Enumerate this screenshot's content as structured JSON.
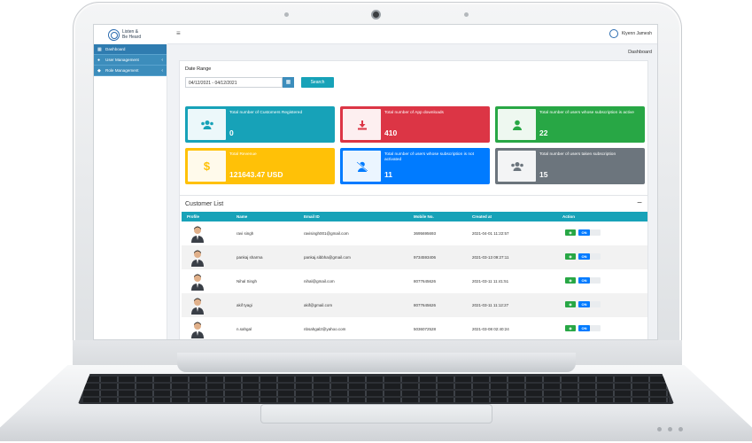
{
  "app": {
    "logo_text_line1": "Listen &",
    "logo_text_line2": "Be Heard",
    "menu_icon": "hamburger-icon"
  },
  "user": {
    "name": "Kiyenn Jamesh"
  },
  "breadcrumb": "Dashboard",
  "sidebar": {
    "items": [
      {
        "label": "Dashboard",
        "icon": "grid-icon",
        "arrow": ""
      },
      {
        "label": "User Management",
        "icon": "user-icon",
        "arrow": "‹"
      },
      {
        "label": "Role Management",
        "icon": "role-icon",
        "arrow": "‹"
      }
    ]
  },
  "filter": {
    "date_range_label": "Date Range",
    "date_range_value": "04/12/2021 - 04/12/2021",
    "search_label": "Search"
  },
  "stats": [
    {
      "label": "Total number of Customers Registered",
      "value": "0",
      "color": "#17a2b8",
      "icon": "users-icon"
    },
    {
      "label": "Total number of App downloads",
      "value": "410",
      "color": "#dc3545",
      "icon": "download-icon"
    },
    {
      "label": "Total number of users whose subscription is active",
      "value": "22",
      "color": "#28a745",
      "icon": "user-icon"
    },
    {
      "label": "Total Revenue",
      "value": "121643.47 USD",
      "color": "#ffc107",
      "icon": "dollar-icon"
    },
    {
      "label": "Total number of users whose subscription is not activated",
      "value": "11",
      "color": "#007bff",
      "icon": "user-slash-icon"
    },
    {
      "label": "Total number of users taken subscription",
      "value": "15",
      "color": "#6c757d",
      "icon": "users-icon"
    }
  ],
  "customer_list": {
    "title": "Customer List",
    "collapse": "−",
    "columns": [
      "Profile",
      "Name",
      "Email ID",
      "Mobile No.",
      "Created at",
      "Action"
    ],
    "rows": [
      {
        "name": "ravi singh",
        "email": "ravisingh001@gmail.com",
        "mobile": "3695695693",
        "created": "2021-04-01 11:22:57"
      },
      {
        "name": "pankaj sharma",
        "email": "pankaj.sibbha@gmail.com",
        "mobile": "9734593406",
        "created": "2021-03-13 09:27:11"
      },
      {
        "name": "Nihal Singh",
        "email": "nihal@gmail.com",
        "mobile": "8077645626",
        "created": "2021-03-11 11:41:51"
      },
      {
        "name": "akif tyagi",
        "email": "akif@gmail.com",
        "mobile": "8077645626",
        "created": "2021-03-11 11:12:27"
      },
      {
        "name": "n.sahgal",
        "email": "nbsahgal2@yahoo.com",
        "mobile": "5036072528",
        "created": "2021-03-08 02:40:24"
      }
    ],
    "toggle_label": "ON",
    "view_icon": "eye-icon"
  }
}
